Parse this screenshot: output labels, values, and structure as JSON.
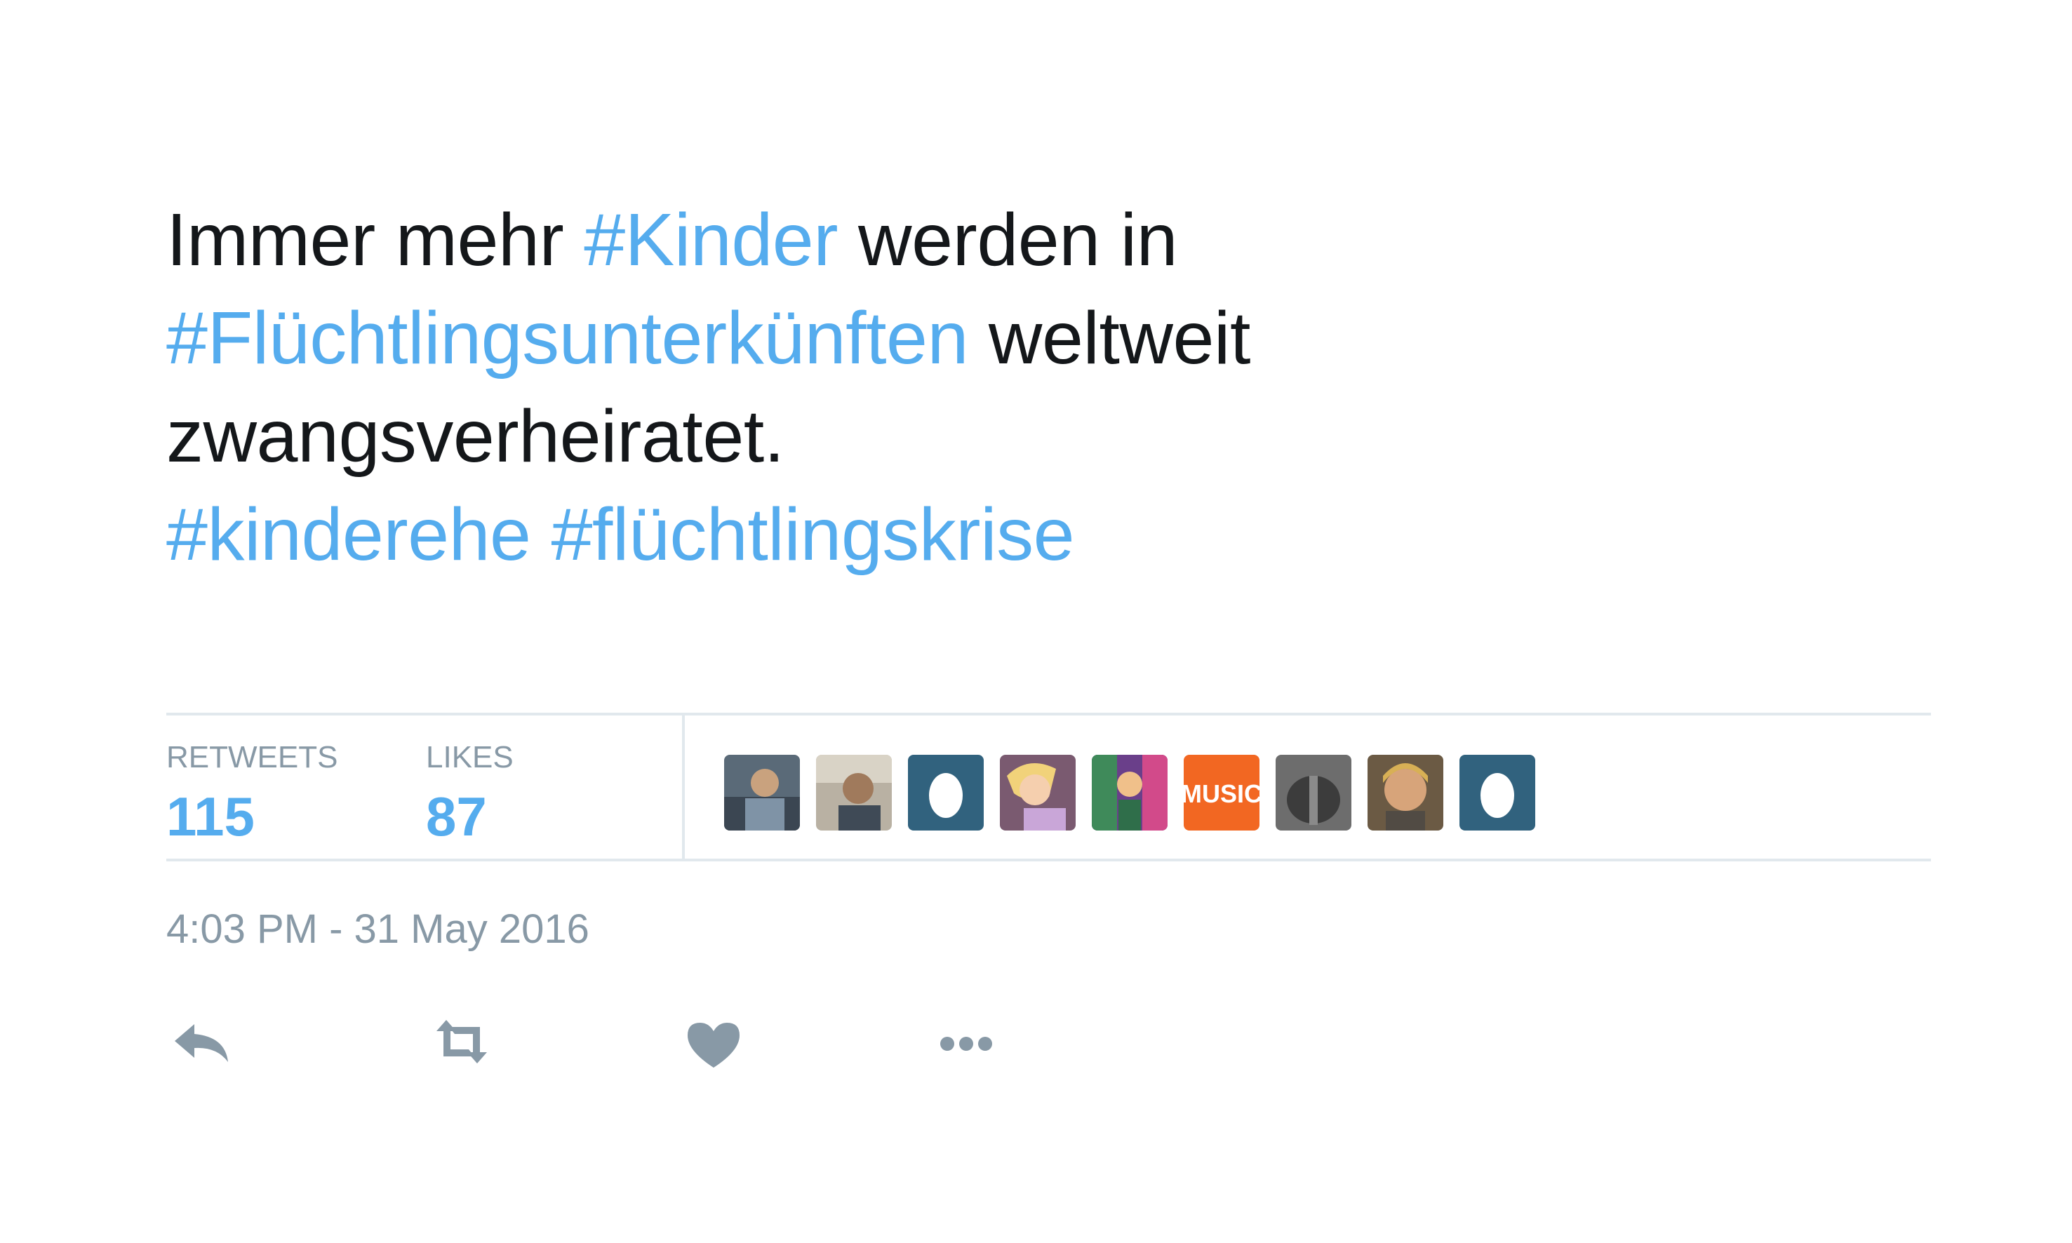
{
  "tweet": {
    "lines": [
      [
        {
          "text": "Immer mehr ",
          "hashtag": false
        },
        {
          "text": "#Kinder",
          "hashtag": true
        },
        {
          "text": " werden in",
          "hashtag": false
        }
      ],
      [
        {
          "text": "#Flüchtlingsunterkünften",
          "hashtag": true
        },
        {
          "text": " weltweit",
          "hashtag": false
        }
      ],
      [
        {
          "text": "zwangsverheiratet.",
          "hashtag": false
        }
      ],
      [
        {
          "text": "#kinderehe",
          "hashtag": true
        },
        {
          "text": " ",
          "hashtag": false
        },
        {
          "text": "#flüchtlingskrise",
          "hashtag": true
        }
      ]
    ]
  },
  "stats": {
    "retweets_label": "RETWEETS",
    "retweets_value": "115",
    "likes_label": "LIKES",
    "likes_value": "87"
  },
  "avatars": [
    {
      "name": "avatar-photo-1",
      "type": "photo"
    },
    {
      "name": "avatar-photo-2",
      "type": "photo"
    },
    {
      "name": "avatar-default-egg-1",
      "type": "egg"
    },
    {
      "name": "avatar-cartoon-princess",
      "type": "cartoon"
    },
    {
      "name": "avatar-colorful-art",
      "type": "art"
    },
    {
      "name": "avatar-music-logo",
      "type": "logo",
      "text": "MUSIC"
    },
    {
      "name": "avatar-photo-back",
      "type": "photo"
    },
    {
      "name": "avatar-photo-man",
      "type": "photo"
    },
    {
      "name": "avatar-default-egg-2",
      "type": "egg"
    }
  ],
  "timestamp": "4:03 PM - 31 May 2016",
  "actions": [
    {
      "name": "reply-button",
      "icon": "reply-icon"
    },
    {
      "name": "retweet-button",
      "icon": "retweet-icon"
    },
    {
      "name": "like-button",
      "icon": "heart-icon"
    },
    {
      "name": "more-button",
      "icon": "more-icon"
    }
  ],
  "colors": {
    "hashtag": "#55acee",
    "text": "#14171a",
    "muted": "#8899a6",
    "divider": "#e1e8ed",
    "egg_bg": "#31627e",
    "music_bg": "#f26722"
  }
}
